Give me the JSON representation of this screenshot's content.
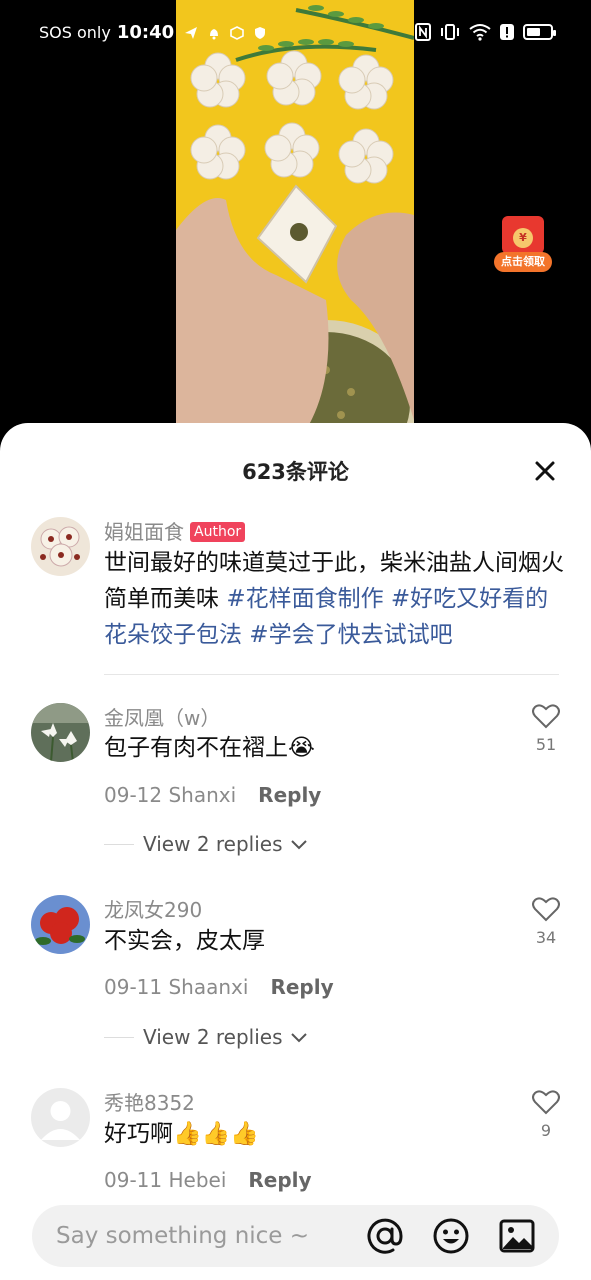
{
  "status_bar": {
    "carrier": "SOS only",
    "time": "10:40",
    "battery_level": 0.6
  },
  "red_packet": {
    "coin_symbol": "¥",
    "label": "点击领取"
  },
  "sheet": {
    "title": "623条评论",
    "close_icon": "close-icon"
  },
  "comments": [
    {
      "username": "娟姐面食",
      "badge": "Author",
      "text_plain": "世间最好的味道莫过于此，柴米油盐人间烟火简单而美味 ",
      "hashtags": "#花样面食制作 #好吃又好看的花朵饺子包法 #学会了快去试试吧"
    },
    {
      "username": "金凤凰（w）",
      "text": "包子有肉不在褶上😭",
      "date_location": "09-12 Shanxi",
      "reply_label": "Reply",
      "likes": "51",
      "view_replies": "View 2 replies"
    },
    {
      "username": "龙凤女290",
      "text": "不实会，皮太厚",
      "date_location": "09-11 Shaanxi",
      "reply_label": "Reply",
      "likes": "34",
      "view_replies": "View 2 replies"
    },
    {
      "username": "秀艳8352",
      "text": "好巧啊👍👍👍",
      "date_location": "09-11 Hebei",
      "reply_label": "Reply",
      "likes": "9"
    }
  ],
  "input_bar": {
    "placeholder": "Say something nice ~",
    "icons": [
      "at-icon",
      "emoji-icon",
      "image-icon"
    ]
  }
}
